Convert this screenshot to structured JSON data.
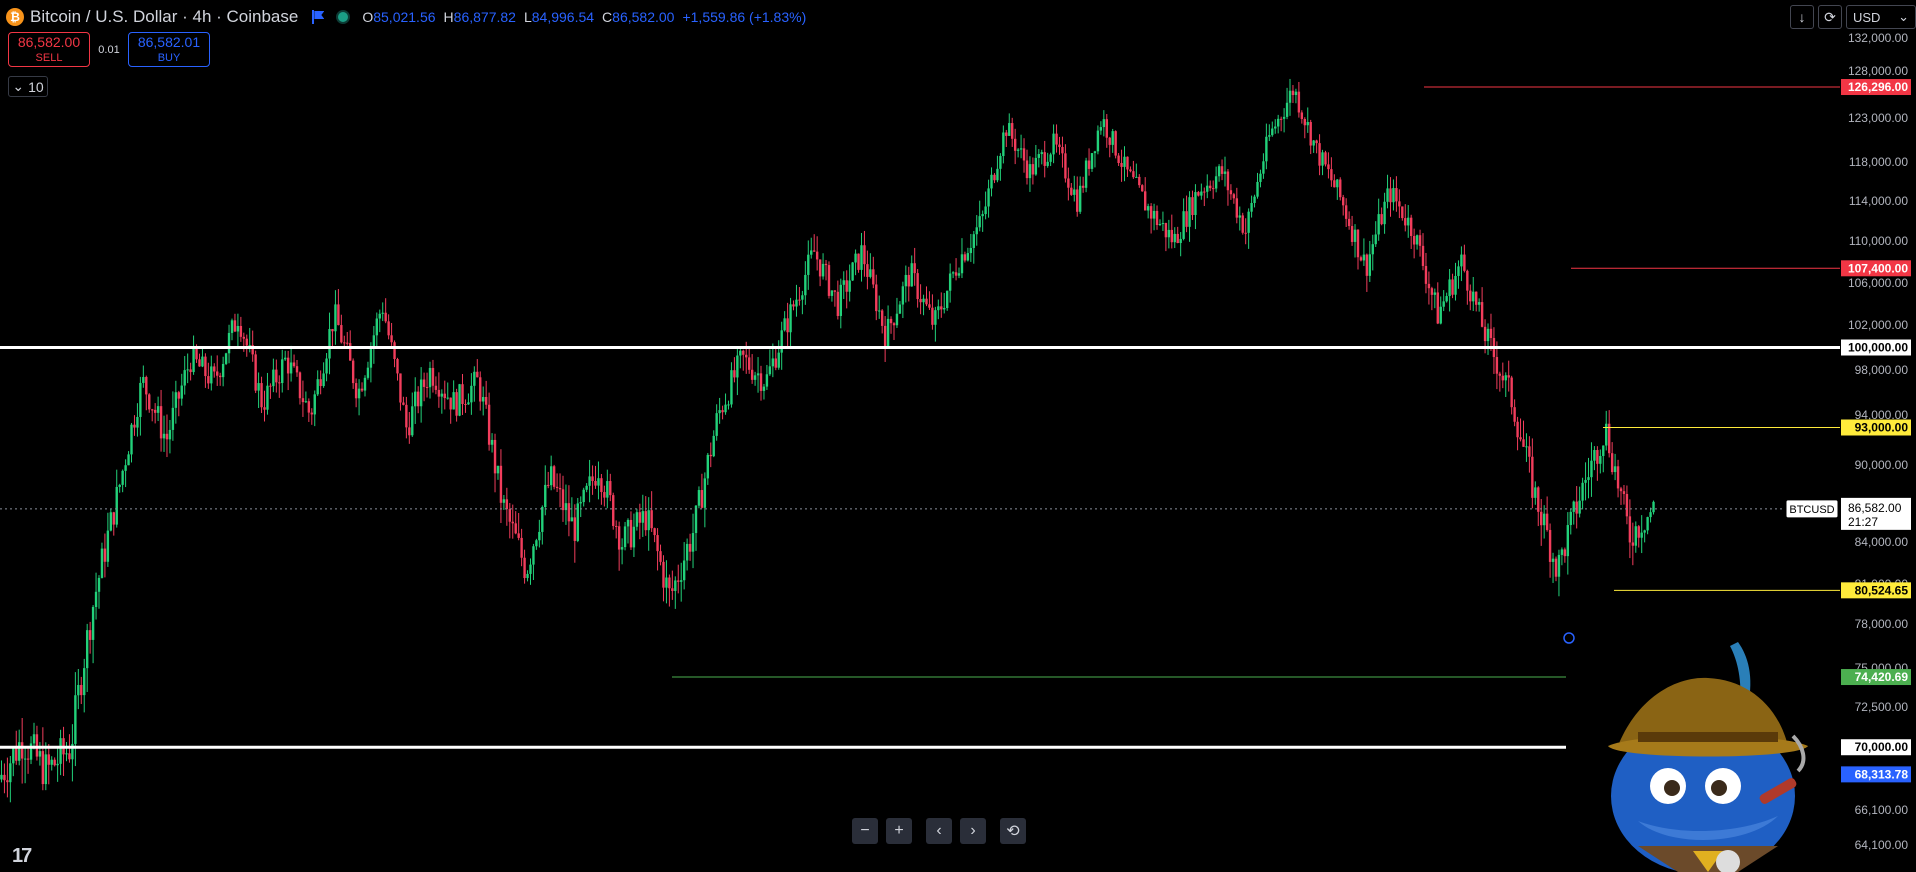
{
  "header": {
    "logo_glyph": "₿",
    "title": "Bitcoin / U.S. Dollar · 4h · Coinbase",
    "ohlc": {
      "o_label": "O",
      "o_value": "85,021.56",
      "h_label": "H",
      "h_value": "86,877.82",
      "l_label": "L",
      "l_value": "84,996.54",
      "c_label": "C",
      "c_value": "86,582.00",
      "change": "+1,559.86 (+1.83%)"
    }
  },
  "trade": {
    "sell_price": "86,582.00",
    "sell_label": "SELL",
    "spread": "0.01",
    "buy_price": "86,582.01",
    "buy_label": "BUY"
  },
  "quantity": {
    "chevron": "⌄",
    "value": "10"
  },
  "toolbar_right": {
    "download_icon": "↓",
    "refresh_icon": "⟳",
    "currency": "USD",
    "currency_chevron": "⌄"
  },
  "zoom_controls": {
    "minus": "−",
    "plus": "+",
    "left": "‹",
    "right": "›",
    "reset": "⟲"
  },
  "brand": {
    "logo_text": "17"
  },
  "colors": {
    "up": "#22d17a",
    "down": "#f23d5c",
    "red_level": "#f23645",
    "yellow_level": "#ffeb3b",
    "green_level": "#4caf50",
    "blue_level": "#2962ff"
  },
  "icons": {
    "mascot": "fish-mascot-with-hat-icon"
  },
  "chart_data": {
    "type": "candlestick",
    "title": "Bitcoin / U.S. Dollar · 4h · Coinbase",
    "xlabel": "",
    "ylabel": "",
    "y_axis_ticks": [
      "132,000.00",
      "128,000.00",
      "123,000.00",
      "118,000.00",
      "114,000.00",
      "110,000.00",
      "106,000.00",
      "102,000.00",
      "98,000.00",
      "94,000.00",
      "90,000.00",
      "84,000.00",
      "81,000.00",
      "78,000.00",
      "75,000.00",
      "72,500.00",
      "66,100.00",
      "64,100.00"
    ],
    "y_axis_tick_values": [
      132000,
      128000,
      123000,
      118000,
      114000,
      110000,
      106000,
      102000,
      98000,
      94000,
      90000,
      84000,
      81000,
      78000,
      75000,
      72500,
      66100,
      64100
    ],
    "grid": false,
    "price_path": [
      68000,
      70500,
      68500,
      70000,
      80000,
      88000,
      97000,
      92000,
      99000,
      97000,
      103000,
      95000,
      99000,
      94000,
      103000,
      96000,
      104000,
      93000,
      98000,
      95000,
      97000,
      87000,
      82000,
      89000,
      85000,
      90000,
      84000,
      86000,
      80000,
      85000,
      94000,
      99000,
      97000,
      103000,
      109000,
      104000,
      109000,
      101000,
      107000,
      102000,
      108000,
      112000,
      122000,
      117000,
      120000,
      114000,
      123000,
      117000,
      113000,
      110000,
      115000,
      117000,
      111000,
      121000,
      126200,
      119000,
      114000,
      107500,
      115000,
      111000,
      103000,
      108000,
      101000,
      96000,
      88000,
      82000,
      88000,
      93000,
      84500,
      86582
    ],
    "levels": [
      {
        "label": "126,296.00",
        "value": 126296,
        "color": "red"
      },
      {
        "label": "107,400.00",
        "value": 107400,
        "color": "red"
      },
      {
        "label": "100,000.00",
        "value": 100000,
        "color": "white"
      },
      {
        "label": "93,000.00",
        "value": 93000,
        "color": "yellow"
      },
      {
        "label": "80,524.65",
        "value": 80524.65,
        "color": "yellow"
      },
      {
        "label": "74,420.69",
        "value": 74420.69,
        "color": "green"
      },
      {
        "label": "70,000.00",
        "value": 70000,
        "color": "white"
      },
      {
        "label": "68,313.78",
        "value": 68313.78,
        "color": "blue"
      }
    ],
    "current_price": {
      "symbol": "BTCUSD",
      "price": "86,582.00",
      "countdown": "21:27",
      "value": 86582
    }
  }
}
